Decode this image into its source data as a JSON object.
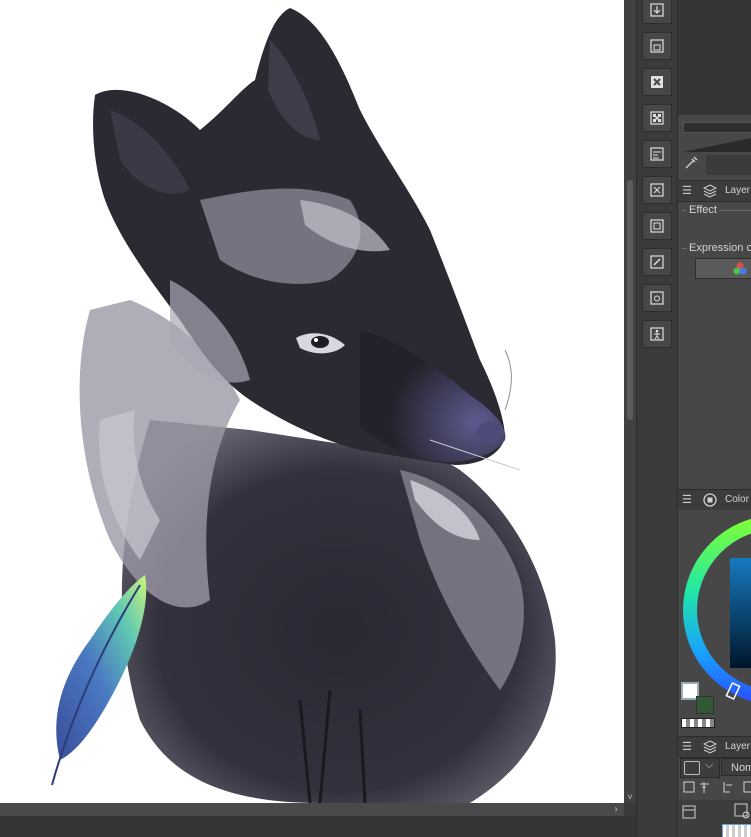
{
  "canvas": {
    "background": "#ffffff",
    "artwork": "fox-painting"
  },
  "canvas_scroll": {
    "down_arrow": "˅",
    "right_arrow": "›"
  },
  "toolbar": {
    "buttons": [
      {
        "name": "import-icon"
      },
      {
        "name": "save-icon"
      },
      {
        "name": "close-file-icon"
      },
      {
        "name": "transparency-icon"
      },
      {
        "name": "layer-property-icon"
      },
      {
        "name": "transform-icon"
      },
      {
        "name": "rasterize-icon"
      },
      {
        "name": "edit-icon"
      },
      {
        "name": "camera-icon"
      },
      {
        "name": "pose-figure-icon"
      }
    ]
  },
  "layer_property_panel": {
    "title": "Layer",
    "effect_label": "Effect",
    "expression_label": "Expression co"
  },
  "color_panel": {
    "title": "Color",
    "main_color": "#ffffff",
    "sub_color": "#2f5a34"
  },
  "layer_panel": {
    "title": "Layer",
    "blend_mode": "Nom"
  },
  "colors": {
    "app_bg": "#3a3a3a",
    "panel_bg": "#474747",
    "title_bg": "#3c3c3c"
  }
}
